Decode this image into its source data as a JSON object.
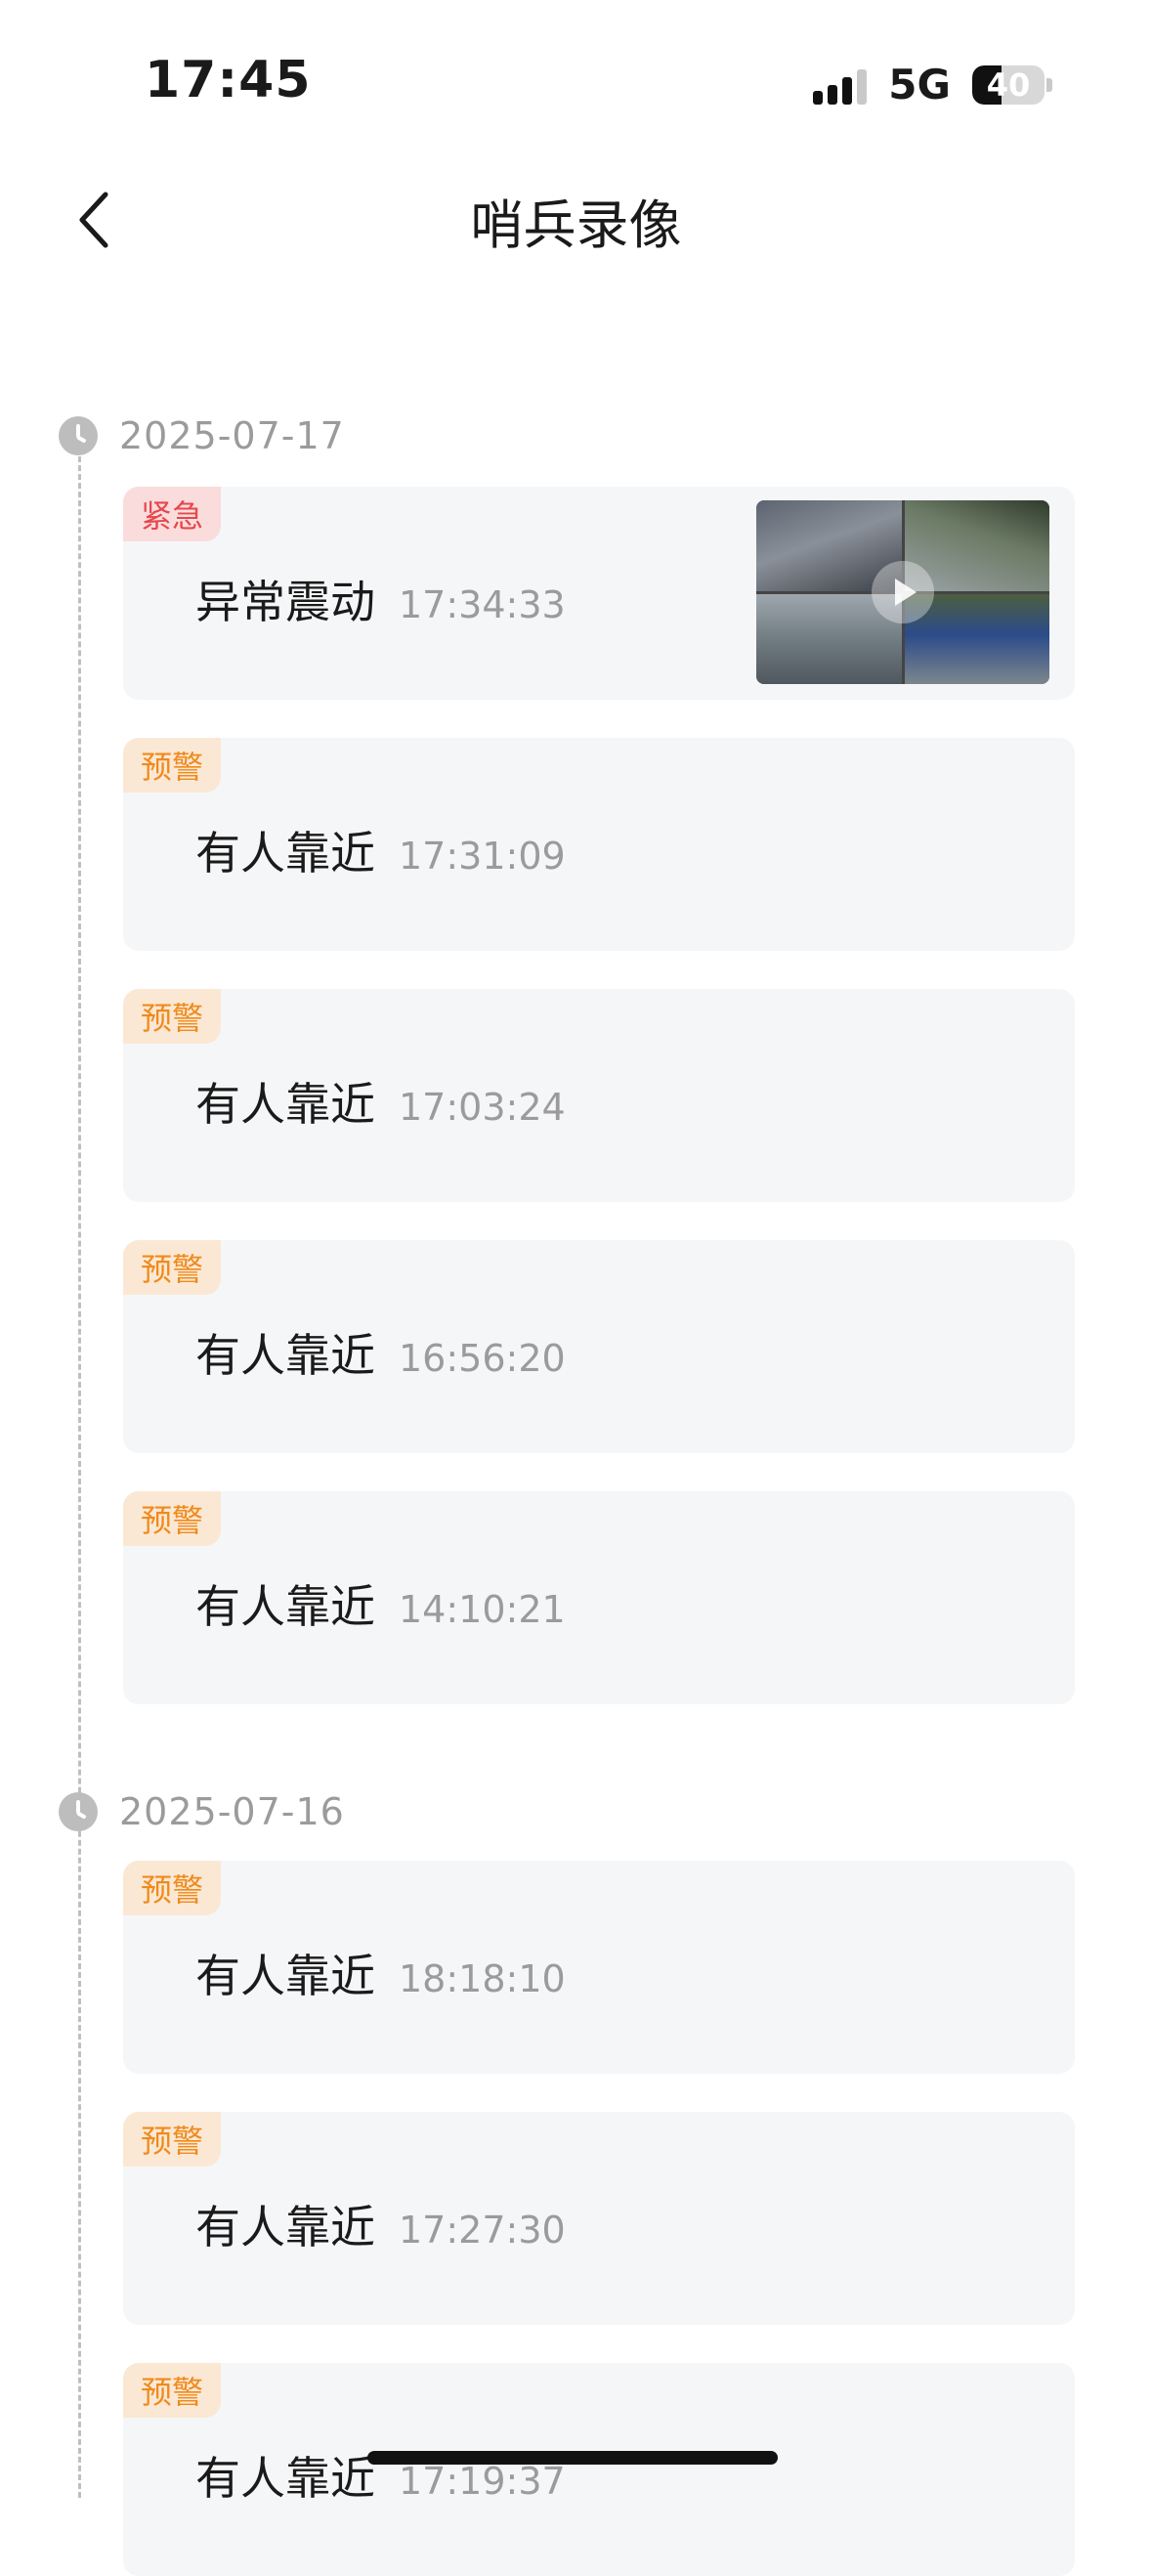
{
  "status_bar": {
    "time": "17:45",
    "network": "5G",
    "battery": "40",
    "battery_level": 0.4
  },
  "header": {
    "title": "哨兵录像",
    "back_icon": "chevron-left-icon"
  },
  "groups": [
    {
      "date": "2025-07-17",
      "events": [
        {
          "tag": "紧急",
          "tag_type": "urgent",
          "title": "异常震动",
          "time": "17:34:33",
          "has_thumbnail": true
        },
        {
          "tag": "预警",
          "tag_type": "warn",
          "title": "有人靠近",
          "time": "17:31:09"
        },
        {
          "tag": "预警",
          "tag_type": "warn",
          "title": "有人靠近",
          "time": "17:03:24"
        },
        {
          "tag": "预警",
          "tag_type": "warn",
          "title": "有人靠近",
          "time": "16:56:20"
        },
        {
          "tag": "预警",
          "tag_type": "warn",
          "title": "有人靠近",
          "time": "14:10:21"
        }
      ]
    },
    {
      "date": "2025-07-16",
      "events": [
        {
          "tag": "预警",
          "tag_type": "warn",
          "title": "有人靠近",
          "time": "18:18:10"
        },
        {
          "tag": "预警",
          "tag_type": "warn",
          "title": "有人靠近",
          "time": "17:27:30"
        },
        {
          "tag": "预警",
          "tag_type": "warn",
          "title": "有人靠近",
          "time": "17:19:37"
        }
      ]
    }
  ],
  "colors": {
    "urgent": "#e5484d",
    "warn": "#f08a1c",
    "card_bg": "#f5f6f8"
  }
}
